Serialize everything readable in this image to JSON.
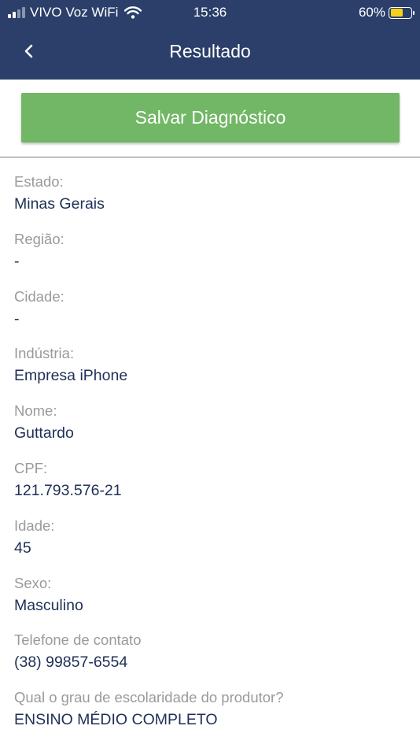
{
  "status_bar": {
    "carrier": "VIVO Voz WiFi",
    "time": "15:36",
    "battery_percent": "60%",
    "battery_level": 0.6,
    "icons": [
      "signal-icon",
      "wifi-icon",
      "battery-icon"
    ]
  },
  "header": {
    "title": "Resultado",
    "back_icon": "chevron-left-icon"
  },
  "save_button": {
    "label": "Salvar Diagnóstico"
  },
  "fields": [
    {
      "label": "Estado:",
      "value": "Minas Gerais"
    },
    {
      "label": "Região:",
      "value": "-"
    },
    {
      "label": "Cidade:",
      "value": "-"
    },
    {
      "label": "Indústria:",
      "value": "Empresa iPhone"
    },
    {
      "label": "Nome:",
      "value": "Guttardo"
    },
    {
      "label": "CPF:",
      "value": "121.793.576-21"
    },
    {
      "label": "Idade:",
      "value": "45"
    },
    {
      "label": "Sexo:",
      "value": "Masculino"
    },
    {
      "label": "Telefone de contato",
      "value": "(38) 99857-6554"
    },
    {
      "label": "Qual o grau de escolaridade do produtor?",
      "value": "ENSINO MÉDIO COMPLETO"
    }
  ],
  "colors": {
    "header_bg": "#2b3f6a",
    "button_bg": "#72b766",
    "label": "#9a9a9a",
    "value": "#1f2f57"
  }
}
